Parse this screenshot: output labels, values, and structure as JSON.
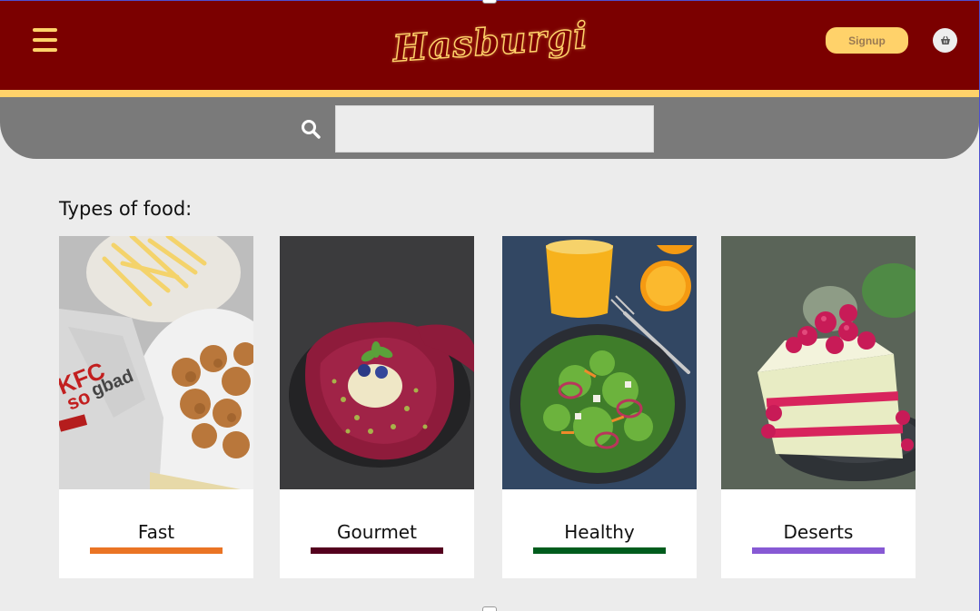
{
  "brand": {
    "logo_text": "Hasburgi",
    "primary_color": "#7b0000",
    "accent_color": "#ffd26a"
  },
  "header": {
    "menu_icon": "hamburger-menu-icon",
    "signup_label": "Signup",
    "cart_icon": "basket-icon"
  },
  "search": {
    "icon": "search-icon",
    "value": "",
    "placeholder": ""
  },
  "section": {
    "title": "Types of food:"
  },
  "categories": [
    {
      "label": "Fast",
      "color": "#ea7424",
      "image": "fried-chicken-and-fries-photo"
    },
    {
      "label": "Gourmet",
      "color": "#54001e",
      "image": "berry-dessert-plate-photo"
    },
    {
      "label": "Healthy",
      "color": "#005c1d",
      "image": "salad-bowl-with-orange-juice-photo"
    },
    {
      "label": "Deserts",
      "color": "#8759d4",
      "image": "raspberry-cake-slice-photo"
    }
  ]
}
